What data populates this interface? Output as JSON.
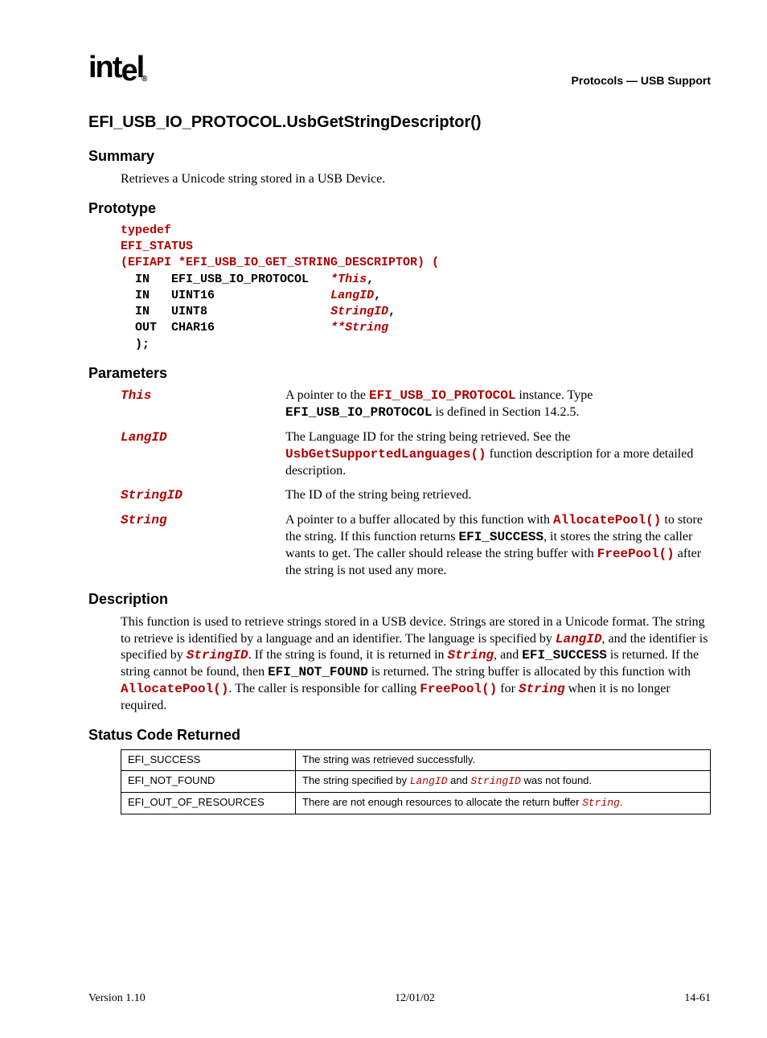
{
  "header": {
    "logo": "intel",
    "section": "Protocols — USB Support"
  },
  "title": "EFI_USB_IO_PROTOCOL.UsbGetStringDescriptor()",
  "summary": {
    "heading": "Summary",
    "text": "Retrieves a Unicode string stored in a USB Device."
  },
  "prototype": {
    "heading": "Prototype",
    "l1": "typedef",
    "l2": "EFI_STATUS",
    "l3a": "(EFIAPI *EFI_USB_IO_GET_STRING_DESCRIPTOR) (",
    "r1_kw": "  IN",
    "r1_type": "EFI_USB_IO_PROTOCOL",
    "r1_arg": "*This",
    "r2_kw": "  IN",
    "r2_type": "UINT16",
    "r2_arg": "LangID",
    "r3_kw": "  IN",
    "r3_type": "UINT8",
    "r3_arg": "StringID",
    "r4_kw": "  OUT",
    "r4_type": "CHAR16",
    "r4_arg": "**String",
    "close": "  );"
  },
  "parameters": {
    "heading": "Parameters",
    "items": [
      {
        "name": "This",
        "desc_pre": "A pointer to the ",
        "code1": "EFI_USB_IO_PROTOCOL",
        "desc_mid": " instance.  Type ",
        "code2": "EFI_USB_IO_PROTOCOL",
        "desc_post": " is defined in Section 14.2.5."
      },
      {
        "name": "LangID",
        "desc_pre": "The Language ID for the string being retrieved.  See the ",
        "code1": "UsbGetSupportedLanguages()",
        "desc_post": " function description for a more detailed description."
      },
      {
        "name": "StringID",
        "desc_pre": "The ID of the string being retrieved."
      },
      {
        "name": "String",
        "desc_pre": "A pointer to a buffer allocated by this function with ",
        "code1": "AllocatePool()",
        "desc_mid": " to store the string.  If this function returns ",
        "code2": "EFI_SUCCESS",
        "desc_mid2": ", it stores the string the caller wants to get.  The caller should release the string buffer with ",
        "code3": "FreePool()",
        "desc_post": " after the string is not used any more."
      }
    ]
  },
  "description": {
    "heading": "Description",
    "pre": "This function is used to retrieve strings stored in a USB device.  Strings are stored in a Unicode format.  The string to retrieve is identified by a language and an identifier.  The language is specified by ",
    "c1": "LangID",
    "t2": ", and the identifier is specified by ",
    "c2": "StringID",
    "t3": ".  If the string is found, it is returned in ",
    "c3": "String",
    "t4": ", and ",
    "c4": "EFI_SUCCESS",
    "t5": " is returned.  If the string cannot be found, then ",
    "c5": "EFI_NOT_FOUND",
    "t6": " is returned.  The string buffer is allocated by this function with ",
    "c6": "AllocatePool()",
    "t7": ".  The caller is responsible for calling ",
    "c7": "FreePool()",
    "t8": " for ",
    "c8": "String",
    "t9": " when it is no longer required."
  },
  "status": {
    "heading": "Status Code Returned",
    "rows": [
      {
        "code": "EFI_SUCCESS",
        "desc": "The string was retrieved successfully."
      },
      {
        "code": "EFI_NOT_FOUND",
        "d1": "The string specified by ",
        "c1": "LangID",
        "d2": " and ",
        "c2": "StringID",
        "d3": " was not found."
      },
      {
        "code": "EFI_OUT_OF_RESOURCES",
        "d1": "There are not enough resources to allocate the return buffer ",
        "c1": "String",
        "d3": "."
      }
    ]
  },
  "footer": {
    "version": "Version 1.10",
    "date": "12/01/02",
    "page": "14-61"
  }
}
